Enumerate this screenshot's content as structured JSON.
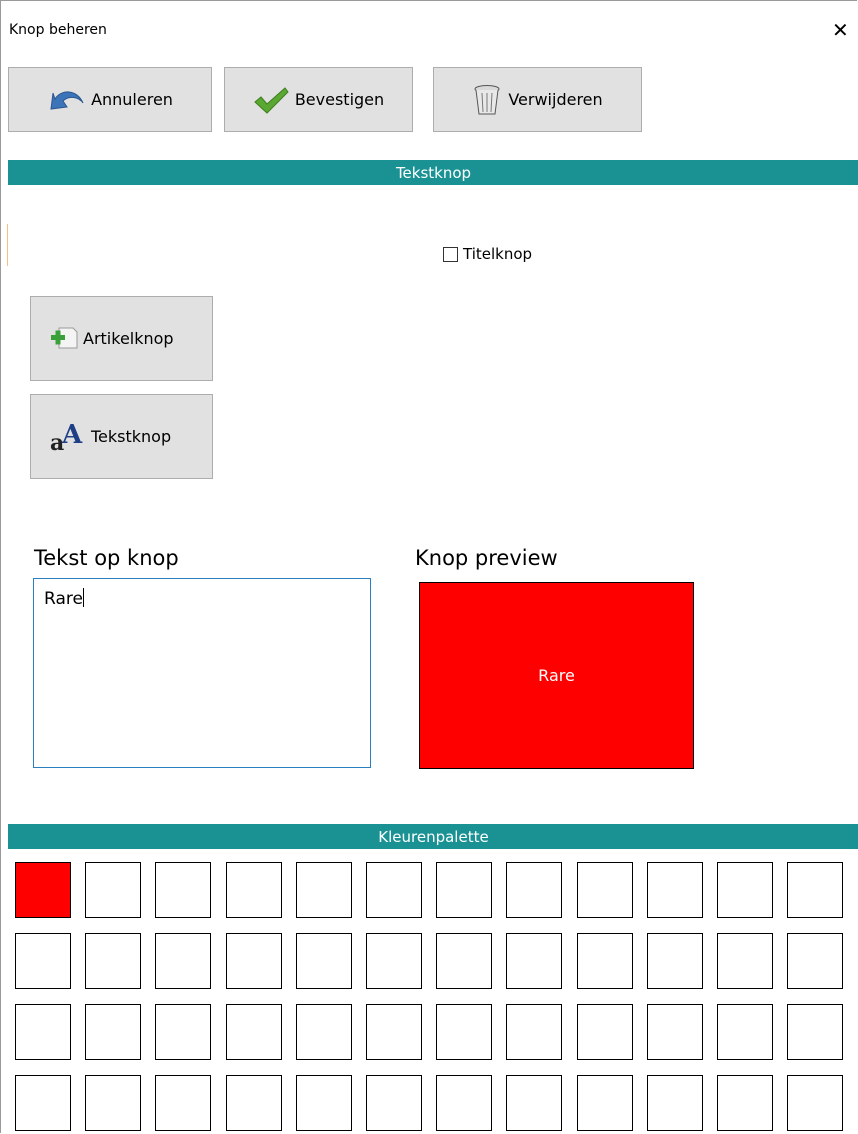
{
  "window": {
    "title": "Knop beheren",
    "close_glyph": "✕"
  },
  "toolbar": {
    "cancel_label": "Annuleren",
    "confirm_label": "Bevestigen",
    "delete_label": "Verwijderen"
  },
  "section_button_type": {
    "title": "Tekstknop"
  },
  "title_checkbox": {
    "label": "Titelknop",
    "checked": false
  },
  "type_buttons": {
    "article_label": "Artikelknop",
    "text_label": "Tekstknop"
  },
  "text_field": {
    "label": "Tekst op knop",
    "value": "Rare"
  },
  "preview": {
    "label": "Knop preview",
    "text": "Rare",
    "bg_color": "#ff0000",
    "text_color": "#ffffff"
  },
  "palette": {
    "title": "Kleurenpalette",
    "accent_color": "#1a9294",
    "colors": [
      "#ff0000",
      "#ffffff",
      "#ffffff",
      "#ffffff",
      "#ffffff",
      "#ffffff",
      "#ffffff",
      "#ffffff",
      "#ffffff",
      "#ffffff",
      "#ffffff",
      "#ffffff",
      "#ffffff",
      "#ffffff",
      "#ffffff",
      "#ffffff",
      "#ffffff",
      "#ffffff",
      "#ffffff",
      "#ffffff",
      "#ffffff",
      "#ffffff",
      "#ffffff",
      "#ffffff",
      "#ffffff",
      "#ffffff",
      "#ffffff",
      "#ffffff",
      "#ffffff",
      "#ffffff",
      "#ffffff",
      "#ffffff",
      "#ffffff",
      "#ffffff",
      "#ffffff",
      "#ffffff",
      "#ffffff",
      "#ffffff",
      "#ffffff",
      "#ffffff",
      "#ffffff",
      "#ffffff",
      "#ffffff",
      "#ffffff",
      "#ffffff",
      "#ffffff",
      "#ffffff",
      "#ffffff"
    ]
  },
  "icons": {
    "cancel": "undo-arrow-icon",
    "confirm": "checkmark-icon",
    "delete": "trash-bin-icon",
    "article": "add-document-icon",
    "text": "font-icon",
    "close": "close-icon"
  }
}
